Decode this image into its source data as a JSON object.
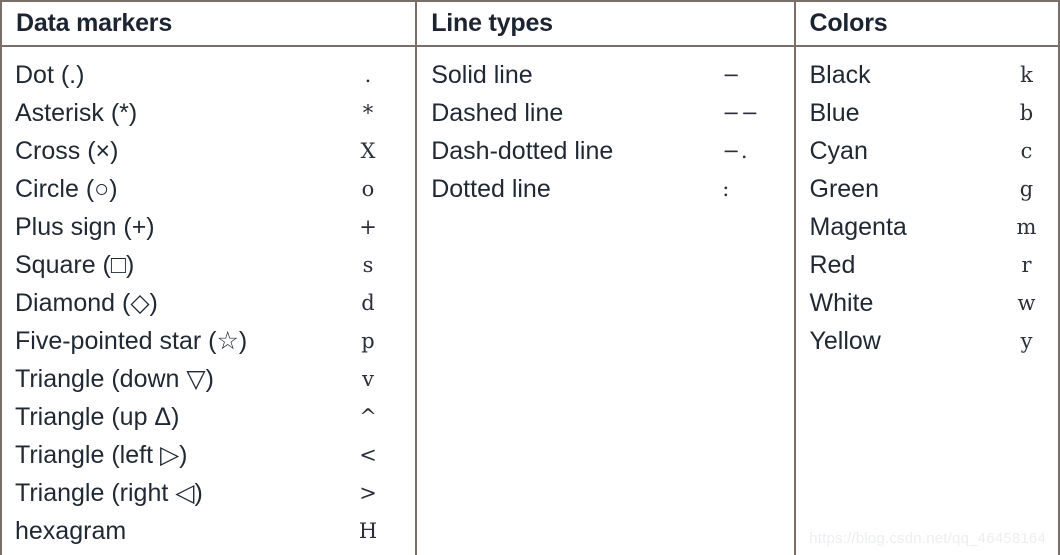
{
  "columns": {
    "markers": {
      "header": "Data markers",
      "rows": [
        {
          "label": "Dot (.)",
          "code": "."
        },
        {
          "label": "Asterisk (*)",
          "code": "*"
        },
        {
          "label": "Cross (×)",
          "code": "X"
        },
        {
          "label": "Circle (○)",
          "code": "o"
        },
        {
          "label": "Plus sign (+)",
          "code": "+"
        },
        {
          "label": "Square (□)",
          "code": "s"
        },
        {
          "label": "Diamond (◇)",
          "code": "d"
        },
        {
          "label": "Five-pointed star (☆)",
          "code": "p"
        },
        {
          "label": "Triangle (down ▽)",
          "code": "v"
        },
        {
          "label": "Triangle (up Δ)",
          "code": "^"
        },
        {
          "label": "Triangle (left ▷)",
          "code": "<"
        },
        {
          "label": "Triangle (right ◁)",
          "code": ">"
        },
        {
          "label": "hexagram",
          "code": "H"
        }
      ]
    },
    "lines": {
      "header": "Line types",
      "rows": [
        {
          "label": "Solid line",
          "code": "−"
        },
        {
          "label": "Dashed line",
          "code": "−−"
        },
        {
          "label": "Dash-dotted line",
          "code": "−."
        },
        {
          "label": "Dotted line",
          "code": ":"
        }
      ]
    },
    "colors": {
      "header": "Colors",
      "rows": [
        {
          "label": "Black",
          "code": "k"
        },
        {
          "label": "Blue",
          "code": "b"
        },
        {
          "label": "Cyan",
          "code": "c"
        },
        {
          "label": "Green",
          "code": "g"
        },
        {
          "label": "Magenta",
          "code": "m"
        },
        {
          "label": "Red",
          "code": "r"
        },
        {
          "label": "White",
          "code": "w"
        },
        {
          "label": "Yellow",
          "code": "y"
        }
      ]
    }
  },
  "watermark": "https://blog.csdn.net/qq_46458164",
  "theme": {
    "border_color": "#7a6e68",
    "text_color": "#1f2833",
    "background": "#ffffff",
    "watermark_color": "#eceef0"
  }
}
